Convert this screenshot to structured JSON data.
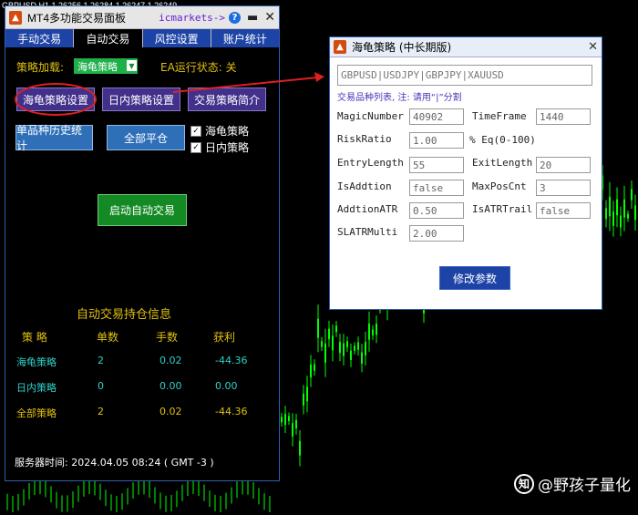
{
  "ticker": "GBPUSD,H1  1.26256 1.26284 1.26247 1.26249",
  "panel": {
    "title": "MT4多功能交易面板",
    "broker": "icmarkets->",
    "help_label": "?",
    "tabs": [
      "手动交易",
      "自动交易",
      "风控设置",
      "账户统计"
    ],
    "strategy_label": "策略加载:",
    "strategy_selected": "海龟策略",
    "ea_status_label": "EA运行状态: 关",
    "btn_turtle_settings": "海龟策略设置",
    "btn_intraday_settings": "日内策略设置",
    "btn_strategy_intro": "交易策略简介",
    "btn_single_history": "单品种历史统计",
    "btn_close_all": "全部平仓",
    "cb_turtle": "海龟策略",
    "cb_intraday": "日内策略",
    "btn_start_auto": "启动自动交易",
    "positions": {
      "title": "自动交易持仓信息",
      "headers": [
        "策 略",
        "单数",
        "手数",
        "获利"
      ],
      "rows": [
        {
          "name": "海龟策略",
          "count": "2",
          "lots": "0.02",
          "profit": "-44.36"
        },
        {
          "name": "日内策略",
          "count": "0",
          "lots": "0.00",
          "profit": "0.00"
        },
        {
          "name": "全部策略",
          "count": "2",
          "lots": "0.02",
          "profit": "-44.36"
        }
      ]
    },
    "server_time": "服务器时间: 2024.04.05 08:24 ( GMT -3 )"
  },
  "dialog": {
    "title": "海龟策略 (中长期版)",
    "symbols_value": "GBPUSD|USDJPY|GBPJPY|XAUUSD",
    "symbols_note": "交易品种列表, 注: 请用“|”分割",
    "params": {
      "MagicNumber": {
        "label": "MagicNumber",
        "value": "40902"
      },
      "TimeFrame": {
        "label": "TimeFrame",
        "value": "1440"
      },
      "RiskRatio": {
        "label": "RiskRatio",
        "value": "1.00"
      },
      "RiskUnit": "% Eq(0-100)",
      "EntryLength": {
        "label": "EntryLength",
        "value": "55"
      },
      "ExitLength": {
        "label": "ExitLength",
        "value": "20"
      },
      "IsAddtion": {
        "label": "IsAddtion",
        "value": "false"
      },
      "MaxPosCnt": {
        "label": "MaxPosCnt",
        "value": "3"
      },
      "AddtionATR": {
        "label": "AddtionATR",
        "value": "0.50"
      },
      "IsATRTrail": {
        "label": "IsATRTrail",
        "value": "false"
      },
      "SLATRMulti": {
        "label": "SLATRMulti",
        "value": "2.00"
      }
    },
    "btn_modify": "修改参数"
  },
  "watermark": {
    "text": "@野孩子量化",
    "icon": "zhihu-icon",
    "icon_glyph": "知"
  },
  "colors": {
    "candle": "#00ff00",
    "arrow": "#e02020",
    "accent_yellow": "#e0c010",
    "accent_cyan": "#30d0c8"
  }
}
